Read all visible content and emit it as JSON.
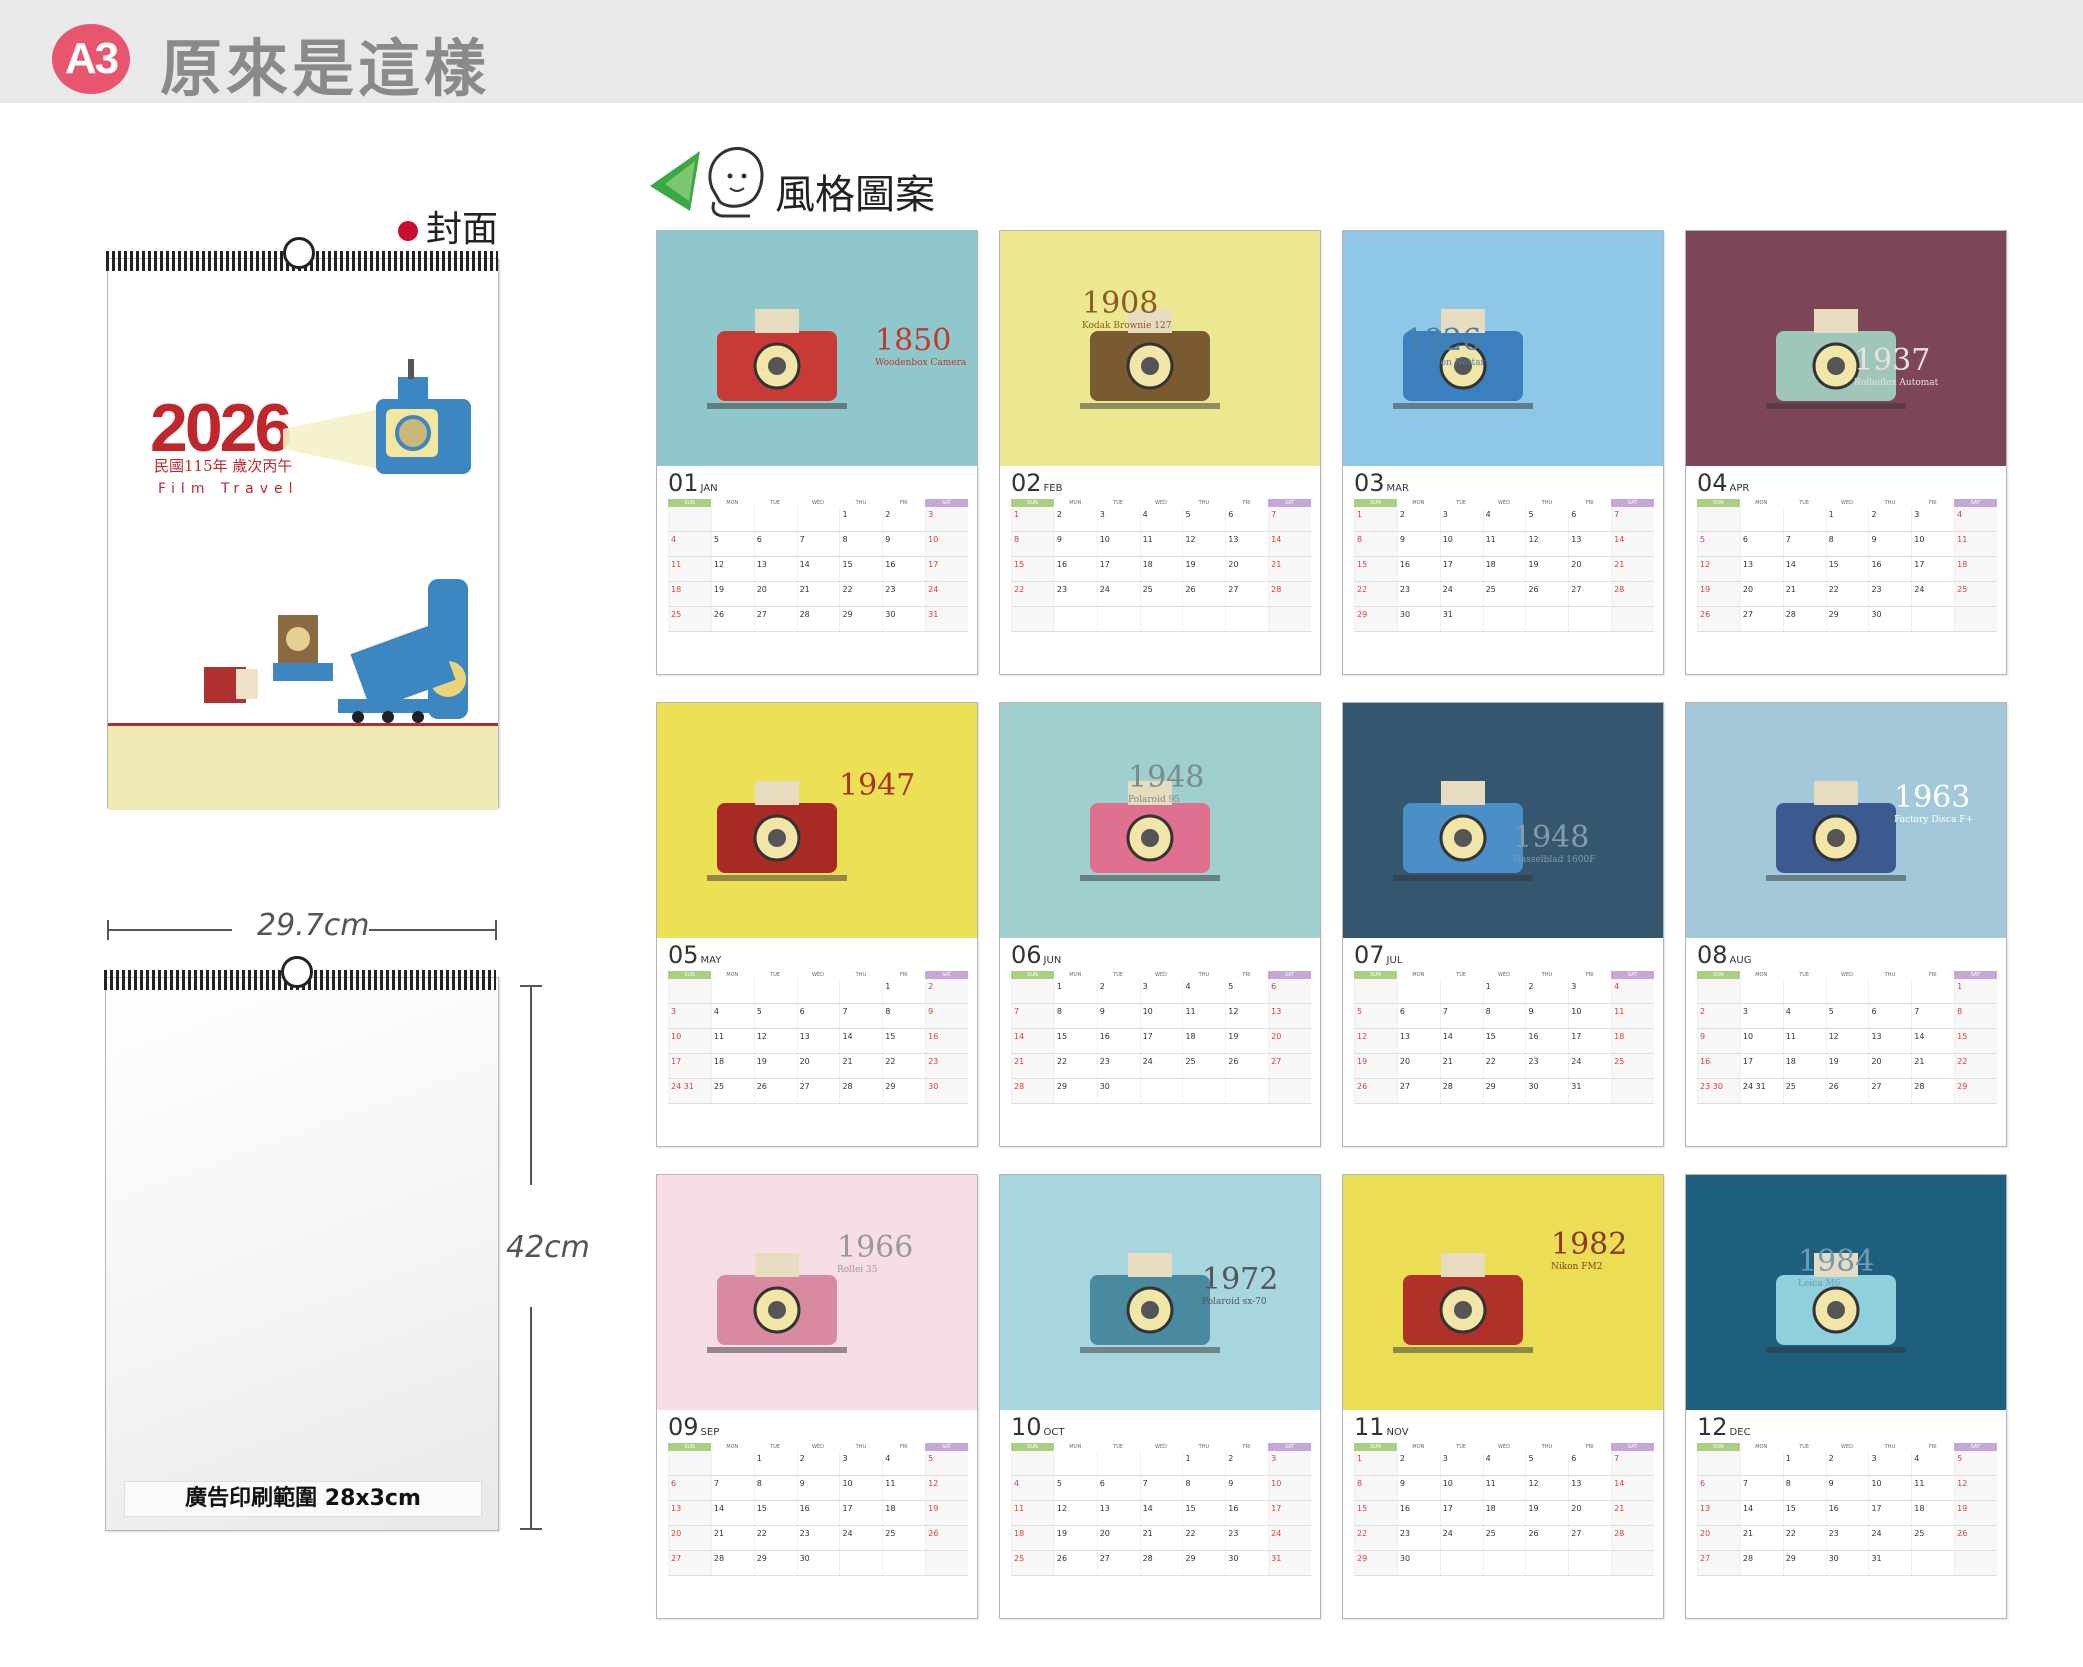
{
  "header": {
    "badge": "A3",
    "title": "原來是這樣"
  },
  "style_label": "風格圖案",
  "cover": {
    "label": "封面",
    "year": "2026",
    "subtitle": "民國115年 歲次丙午",
    "tagline": "Film Travel"
  },
  "blank_sheet": {
    "ad_strip": "廣告印刷範圍 28x3cm"
  },
  "dimensions": {
    "width": "29.7cm",
    "height": "42cm"
  },
  "weekdays": [
    "SUN",
    "MON",
    "TUE",
    "WED",
    "THU",
    "FRI",
    "SAT"
  ],
  "colors": {
    "badge": "#e8556f",
    "cover_red": "#c0272d",
    "sun_header": "#a8d080",
    "sat_header": "#c6a6d6"
  },
  "months": [
    {
      "num": "01",
      "abbr": "JAN",
      "bg": "#8ec8cc",
      "year": "1850",
      "model": "Woodenbox Camera",
      "year_color": "#c0392b",
      "start": 4,
      "days": 31
    },
    {
      "num": "02",
      "abbr": "FEB",
      "bg": "#ece88f",
      "year": "1908",
      "model": "Kodak Brownie 127",
      "year_color": "#8a5a2a",
      "start": 0,
      "days": 28
    },
    {
      "num": "03",
      "abbr": "MAR",
      "bg": "#8fc8e6",
      "year": "1926",
      "model": "Zeiss Ikon Nettar",
      "year_color": "#4a7ea8",
      "start": 0,
      "days": 31
    },
    {
      "num": "04",
      "abbr": "APR",
      "bg": "#7d4558",
      "year": "1937",
      "model": "Rolleiflex Automat",
      "year_color": "#e8e0e4",
      "start": 3,
      "days": 30
    },
    {
      "num": "05",
      "abbr": "MAY",
      "bg": "#ece154",
      "year": "1947",
      "model": "",
      "year_color": "#b03020",
      "start": 5,
      "days": 31
    },
    {
      "num": "06",
      "abbr": "JUN",
      "bg": "#9fcfcf",
      "year": "1948",
      "model": "Polaroid 95",
      "year_color": "#7a8c8c",
      "start": 1,
      "days": 30
    },
    {
      "num": "07",
      "abbr": "JUL",
      "bg": "#34566e",
      "year": "1948",
      "model": "Hasselblad 1600F",
      "year_color": "#8899a8",
      "start": 3,
      "days": 31
    },
    {
      "num": "08",
      "abbr": "AUG",
      "bg": "#a3c8d9",
      "year": "1963",
      "model": "Factory Disca F+",
      "year_color": "#ffffff",
      "start": 6,
      "days": 31
    },
    {
      "num": "09",
      "abbr": "SEP",
      "bg": "#f6dde6",
      "year": "1966",
      "model": "Rollei 35",
      "year_color": "#999999",
      "start": 2,
      "days": 30
    },
    {
      "num": "10",
      "abbr": "OCT",
      "bg": "#a8d6df",
      "year": "1972",
      "model": "Polaroid sx-70",
      "year_color": "#555555",
      "start": 4,
      "days": 31
    },
    {
      "num": "11",
      "abbr": "NOV",
      "bg": "#ebde55",
      "year": "1982",
      "model": "Nikon FM2",
      "year_color": "#8a3a2a",
      "start": 0,
      "days": 30
    },
    {
      "num": "12",
      "abbr": "DEC",
      "bg": "#1e5f80",
      "year": "1984",
      "model": "Leica M6",
      "year_color": "#6f9bb5",
      "start": 2,
      "days": 31
    }
  ]
}
